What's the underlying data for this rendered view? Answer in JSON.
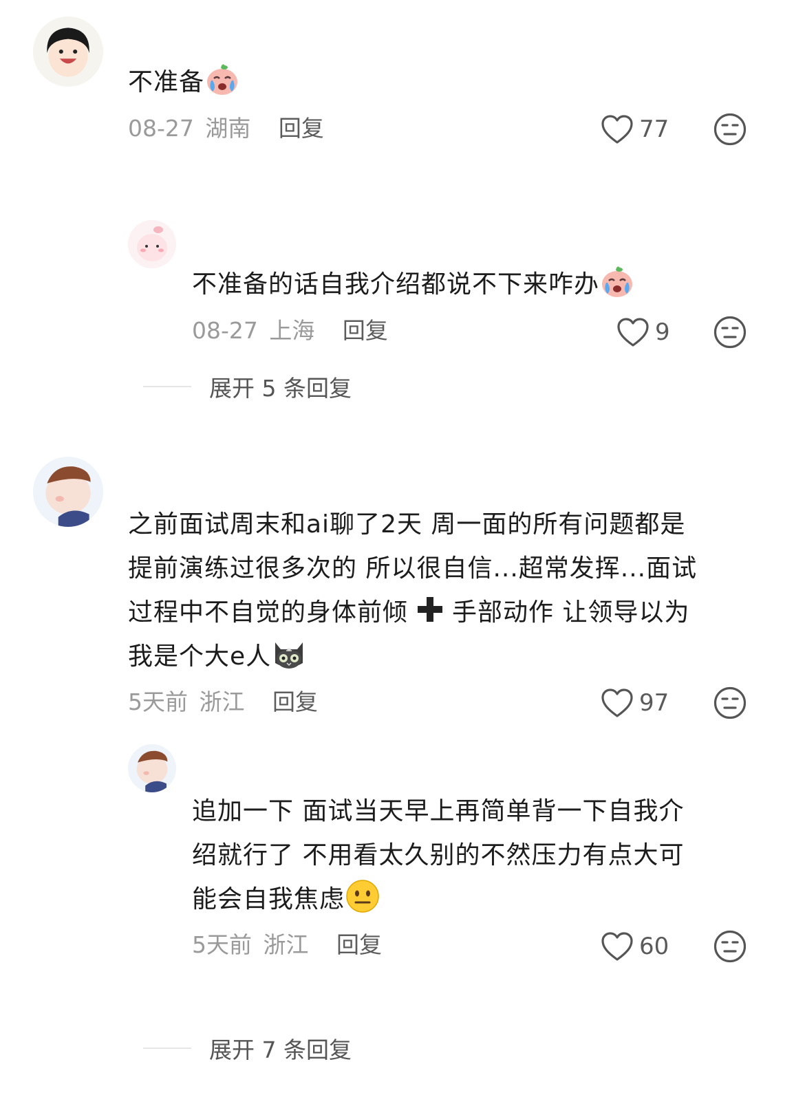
{
  "comments": [
    {
      "avatar": "child-avatar",
      "text": "不准备",
      "emoji": "crying-peach-emoji",
      "date": "08-27",
      "location": "湖南",
      "reply_label": "回复",
      "likes": "77"
    },
    {
      "avatar": "pink-bunny-avatar",
      "text": "不准备的话自我介绍都说不下来咋办",
      "emoji": "crying-peach-emoji",
      "date": "08-27",
      "location": "上海",
      "reply_label": "回复",
      "likes": "9"
    },
    {
      "avatar": "cartoon-boy-avatar",
      "text_lines": [
        "之前面试周末和ai聊了2天 周一面的所有问题都是",
        "提前演练过很多次的 所以很自信...超常发挥...面试",
        "过程中不自觉的身体前倾",
        "手部动作 让领导以为",
        "我是个大e人"
      ],
      "emoji": "gray-cat-emoji",
      "plus_emoji": "heavy-plus-emoji",
      "date": "5天前",
      "location": "浙江",
      "reply_label": "回复",
      "likes": "97"
    },
    {
      "avatar": "cartoon-boy-avatar",
      "text_lines": [
        "追加一下 面试当天早上再简单背一下自我介",
        "绍就行了 不用看太久别的不然压力有点大可",
        "能会自我焦虑"
      ],
      "emoji": "neutral-face-emoji",
      "date": "5天前",
      "location": "浙江",
      "reply_label": "回复",
      "likes": "60"
    }
  ],
  "expand_1": "展开 5 条回复",
  "expand_2": "展开 7 条回复",
  "colors": {
    "text": "#1c1c1c",
    "meta": "#9a9a9a",
    "divider": "#e6e6e6"
  }
}
